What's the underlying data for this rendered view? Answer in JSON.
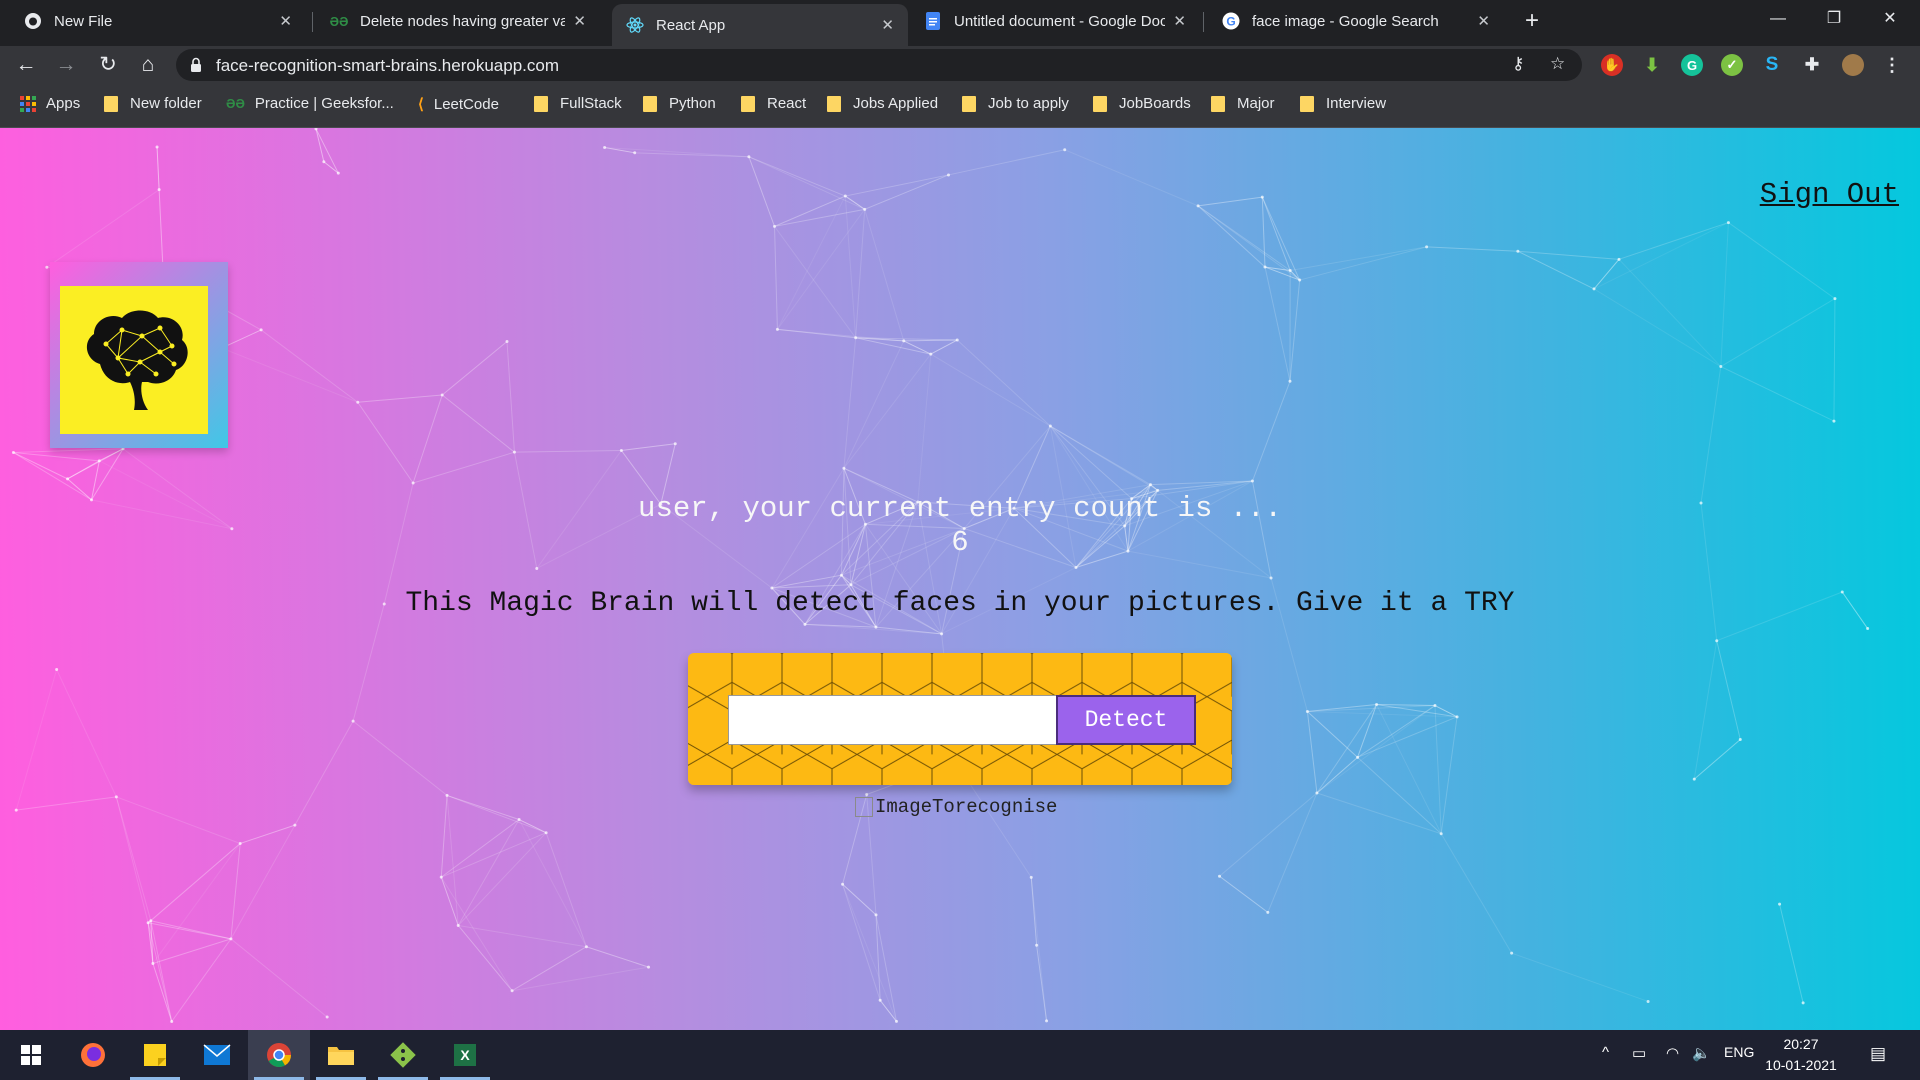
{
  "browser": {
    "tabs": [
      {
        "label": "New File",
        "icon": "github-icon"
      },
      {
        "label": "Delete nodes having greater valu",
        "icon": "gfg-icon"
      },
      {
        "label": "React App",
        "icon": "react-icon",
        "active": true
      },
      {
        "label": "Untitled document - Google Doc",
        "icon": "google-docs-icon"
      },
      {
        "label": "face image - Google Search",
        "icon": "google-icon"
      }
    ],
    "url": "face-recognition-smart-brains.herokuapp.com",
    "bookmarks": [
      "Apps",
      "New folder",
      "Practice | Geeksfor...",
      "LeetCode",
      "FullStack",
      "Python",
      "React",
      "Jobs Applied",
      "Job to apply",
      "JobBoards",
      "Major",
      "Interview"
    ]
  },
  "app": {
    "sign_out": "Sign Out",
    "rank_text": "user, your current entry count is ...",
    "rank_count": "6",
    "intro": "This Magic Brain will detect faces in your pictures. Give it a TRY",
    "input_value": "",
    "detect_label": "Detect",
    "image_alt": "ImageTorecognise",
    "colors": {
      "gradient_left": "#ff5edf",
      "gradient_right": "#04c8de",
      "panel": "#fdb913",
      "button": "#9b63ec",
      "logo_bg": "#fbee23"
    }
  },
  "taskbar": {
    "language": "ENG",
    "time": "20:27",
    "date": "10-01-2021"
  }
}
